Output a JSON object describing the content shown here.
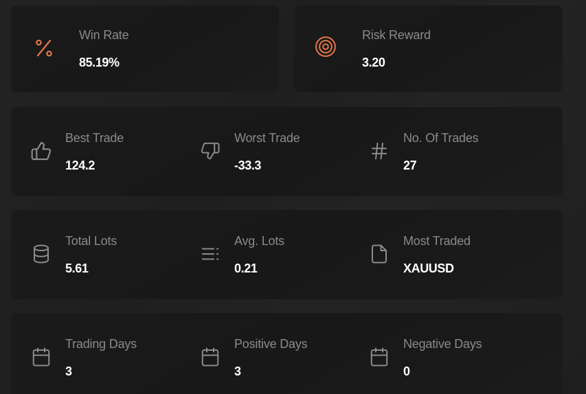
{
  "colors": {
    "accent": "#e8764a",
    "icon_muted": "#8c8c8c",
    "card_bg": "#181818",
    "page_bg": "#1f1f1f"
  },
  "top": {
    "win_rate": {
      "label": "Win Rate",
      "value": "85.19%",
      "icon": "percent-icon"
    },
    "risk_reward": {
      "label": "Risk Reward",
      "value": "3.20",
      "icon": "target-icon"
    }
  },
  "row1": {
    "best_trade": {
      "label": "Best Trade",
      "value": "124.2",
      "icon": "thumbs-up-icon"
    },
    "worst_trade": {
      "label": "Worst Trade",
      "value": "-33.3",
      "icon": "thumbs-down-icon"
    },
    "num_trades": {
      "label": "No. Of Trades",
      "value": "27",
      "icon": "hash-icon"
    }
  },
  "row2": {
    "total_lots": {
      "label": "Total Lots",
      "value": "5.61",
      "icon": "database-icon"
    },
    "avg_lots": {
      "label": "Avg. Lots",
      "value": "0.21",
      "icon": "list-icon"
    },
    "most_traded": {
      "label": "Most Traded",
      "value": "XAUUSD",
      "icon": "file-icon"
    }
  },
  "row3": {
    "trading_days": {
      "label": "Trading Days",
      "value": "3",
      "icon": "calendar-icon"
    },
    "positive_days": {
      "label": "Positive Days",
      "value": "3",
      "icon": "calendar-icon"
    },
    "negative_days": {
      "label": "Negative Days",
      "value": "0",
      "icon": "calendar-icon"
    }
  }
}
